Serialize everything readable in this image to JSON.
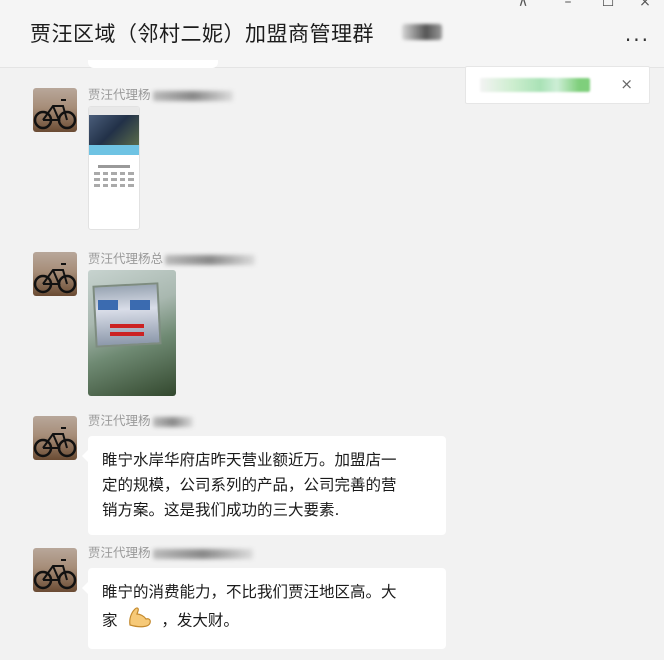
{
  "window": {
    "title": "贾汪区域（邻村二妮）加盟商管理群",
    "controls": [
      "pin-icon",
      "minimize-icon",
      "maximize-icon",
      "close-icon"
    ],
    "more_label": "···"
  },
  "notice": {
    "close_label": "×"
  },
  "messages": [
    {
      "sender": "贾汪代理杨",
      "type": "image"
    },
    {
      "sender": "贾汪代理杨总",
      "type": "image"
    },
    {
      "sender": "贾汪代理杨",
      "type": "text",
      "lines": [
        "睢宁水岸华府店昨天营业额近万。加盟店一",
        "定的规模，公司系列的产品，公司完善的营",
        "销方案。这是我们成功的三大要素."
      ]
    },
    {
      "sender": "贾汪代理杨",
      "type": "text",
      "lines": [
        "睢宁的消费能力，不比我们贾汪地区高。大",
        "家",
        "，发大财。"
      ],
      "emoji": "flexed-biceps-icon"
    }
  ],
  "colors": {
    "background": "#f2f2f2",
    "bubble": "#ffffff",
    "sender": "#9a9a9a"
  }
}
